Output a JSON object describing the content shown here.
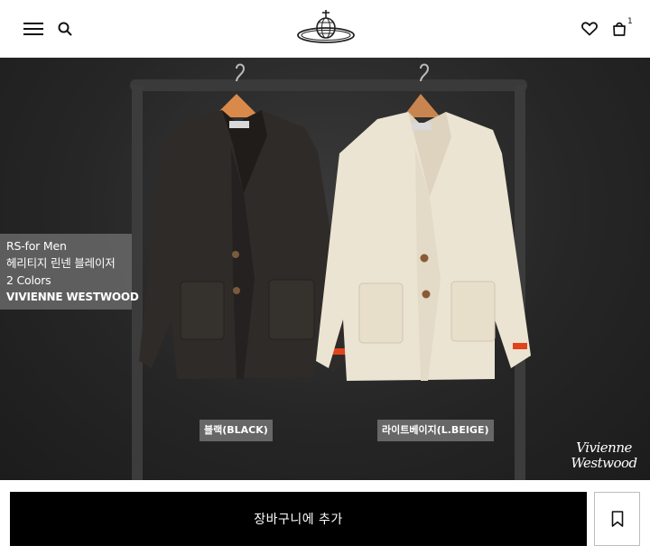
{
  "header": {
    "menu_icon": "hamburger-menu-icon",
    "search_icon": "search-icon",
    "logo": "vivienne-westwood-orb-logo",
    "wishlist_icon": "heart-icon",
    "cart_icon": "shopping-bag-icon",
    "cart_count": "1"
  },
  "product": {
    "overlay": {
      "line1": "RS-for Men",
      "line2": "헤리티지 린넨 블레이저",
      "line3": "2 Colors",
      "line4": "VIVIENNE WESTWOOD"
    },
    "colors": [
      {
        "label": "블랙(BLACK)",
        "swatch": "#2e2a27"
      },
      {
        "label": "라이트베이지(L.BEIGE)",
        "swatch": "#e8e0cf"
      }
    ],
    "watermark_line1": "Vivienne",
    "watermark_line2": "Westwood"
  },
  "actions": {
    "add_to_cart_label": "장바구니에 추가",
    "bookmark_icon": "bookmark-icon"
  },
  "colors": {
    "background_dark": "#262626",
    "button_black": "#000000",
    "accent_orange": "#e0441c"
  }
}
